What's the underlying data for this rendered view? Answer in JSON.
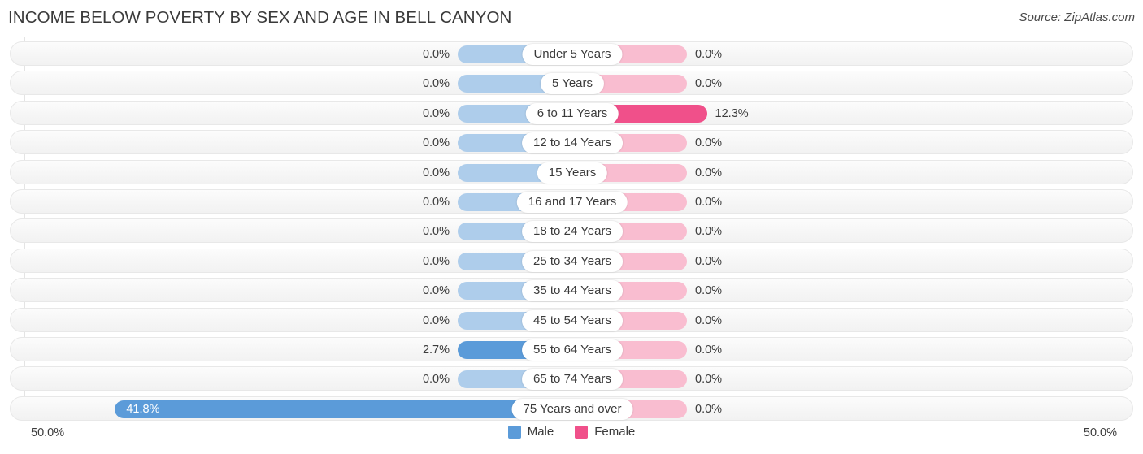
{
  "header": {
    "title": "INCOME BELOW POVERTY BY SEX AND AGE IN BELL CANYON",
    "source": "Source: ZipAtlas.com"
  },
  "axis": {
    "left_end": "50.0%",
    "right_end": "50.0%"
  },
  "legend": {
    "items": [
      {
        "label": "Male",
        "color": "#5b9bd9"
      },
      {
        "label": "Female",
        "color": "#f0508a"
      }
    ]
  },
  "colors": {
    "male_light": "#aecdeb",
    "male_strong": "#5b9bd9",
    "female_light": "#f9bdd0",
    "female_strong": "#f0508a",
    "row_background": "#f6f6f6",
    "gridline": "#e4e4e4"
  },
  "chart_data": {
    "type": "bar",
    "orientation": "horizontal-diverging",
    "title": "INCOME BELOW POVERTY BY SEX AND AGE IN BELL CANYON",
    "xlabel": "",
    "ylabel": "",
    "xlim": [
      -50.0,
      50.0
    ],
    "axis_left_label": "50.0%",
    "axis_right_label": "50.0%",
    "grid": true,
    "legend_position": "bottom-center",
    "categories": [
      "Under 5 Years",
      "5 Years",
      "6 to 11 Years",
      "12 to 14 Years",
      "15 Years",
      "16 and 17 Years",
      "18 to 24 Years",
      "25 to 34 Years",
      "35 to 44 Years",
      "45 to 54 Years",
      "55 to 64 Years",
      "65 to 74 Years",
      "75 Years and over"
    ],
    "series": [
      {
        "name": "Male",
        "side": "left",
        "values": [
          0.0,
          0.0,
          0.0,
          0.0,
          0.0,
          0.0,
          0.0,
          0.0,
          0.0,
          0.0,
          2.7,
          0.0,
          41.8
        ],
        "labels": [
          "0.0%",
          "0.0%",
          "0.0%",
          "0.0%",
          "0.0%",
          "0.0%",
          "0.0%",
          "0.0%",
          "0.0%",
          "0.0%",
          "2.7%",
          "0.0%",
          "41.8%"
        ]
      },
      {
        "name": "Female",
        "side": "right",
        "values": [
          0.0,
          0.0,
          12.3,
          0.0,
          0.0,
          0.0,
          0.0,
          0.0,
          0.0,
          0.0,
          0.0,
          0.0,
          0.0
        ],
        "labels": [
          "0.0%",
          "0.0%",
          "12.3%",
          "0.0%",
          "0.0%",
          "0.0%",
          "0.0%",
          "0.0%",
          "0.0%",
          "0.0%",
          "0.0%",
          "0.0%",
          "0.0%"
        ]
      }
    ]
  }
}
